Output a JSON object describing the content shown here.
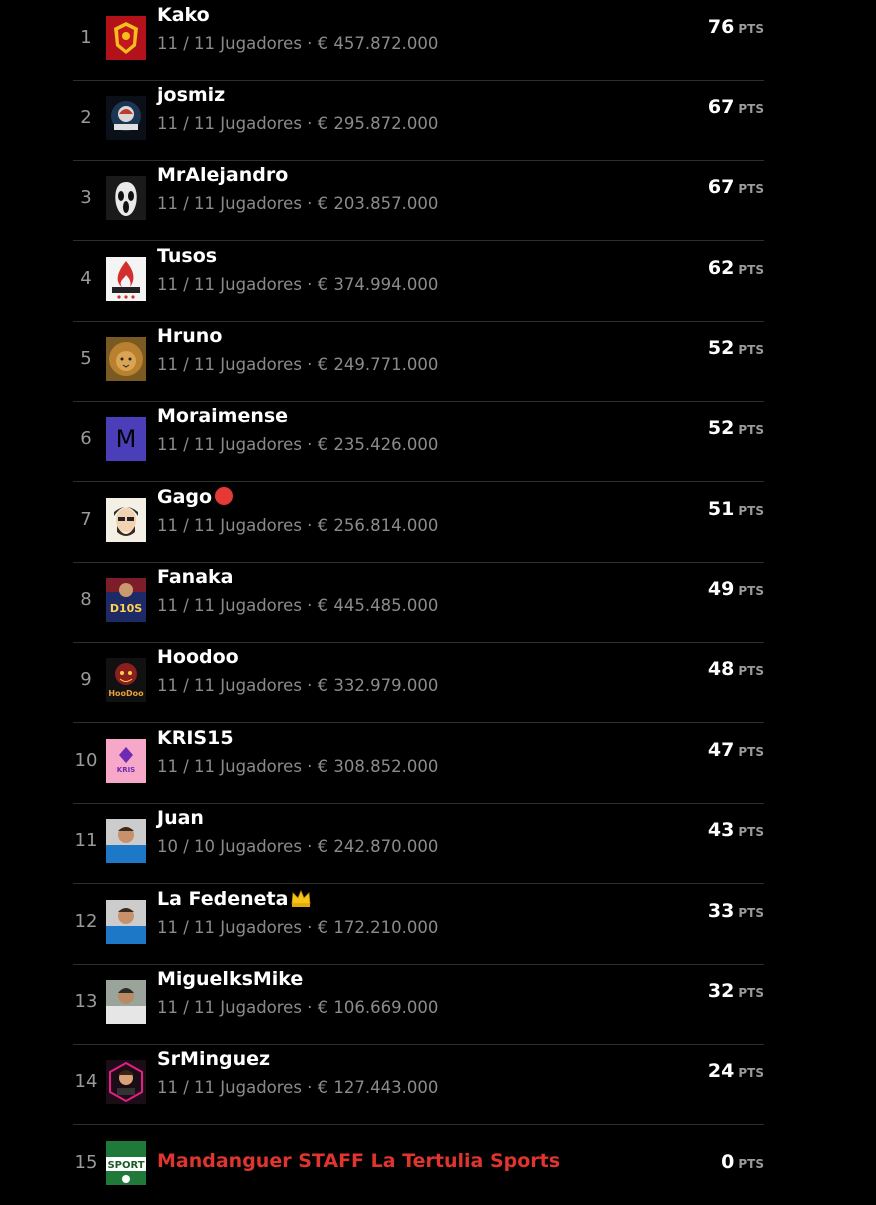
{
  "pts_unit": "PTS",
  "ranking": [
    {
      "rank": "1",
      "name": "Kako",
      "players": "11 / 11 Jugadores",
      "value": "€ 457.872.000",
      "points": "76",
      "avatar": "crest-avatar",
      "staff": false,
      "emoji": ""
    },
    {
      "rank": "2",
      "name": "josmiz",
      "players": "11 / 11 Jugadores",
      "value": "€ 295.872.000",
      "points": "67",
      "avatar": "mascot-logo-avatar",
      "staff": false,
      "emoji": ""
    },
    {
      "rank": "3",
      "name": "MrAlejandro",
      "players": "11 / 11 Jugadores",
      "value": "€ 203.857.000",
      "points": "67",
      "avatar": "ghost-mask-avatar",
      "staff": false,
      "emoji": ""
    },
    {
      "rank": "4",
      "name": "Tusos",
      "players": "11 / 11 Jugadores",
      "value": "€ 374.994.000",
      "points": "62",
      "avatar": "flame-logo-avatar",
      "staff": false,
      "emoji": ""
    },
    {
      "rank": "5",
      "name": "Hruno",
      "players": "11 / 11 Jugadores",
      "value": "€ 249.771.000",
      "points": "52",
      "avatar": "lion-avatar",
      "staff": false,
      "emoji": ""
    },
    {
      "rank": "6",
      "name": "Moraimense",
      "players": "11 / 11 Jugadores",
      "value": "€ 235.426.000",
      "points": "52",
      "avatar": "letter-avatar",
      "letter": "M",
      "staff": false,
      "emoji": ""
    },
    {
      "rank": "7",
      "name": "Gago",
      "players": "11 / 11 Jugadores",
      "value": "€ 256.814.000",
      "points": "51",
      "avatar": "cartoon-face-avatar",
      "staff": false,
      "emoji": "red-circle-icon"
    },
    {
      "rank": "8",
      "name": "Fanaka",
      "players": "11 / 11 Jugadores",
      "value": "€ 445.485.000",
      "points": "49",
      "avatar": "dios-avatar",
      "staff": false,
      "emoji": ""
    },
    {
      "rank": "9",
      "name": "Hoodoo",
      "players": "11 / 11 Jugadores",
      "value": "€ 332.979.000",
      "points": "48",
      "avatar": "hoodoo-logo-avatar",
      "staff": false,
      "emoji": ""
    },
    {
      "rank": "10",
      "name": "KRIS15",
      "players": "11 / 11 Jugadores",
      "value": "€ 308.852.000",
      "points": "47",
      "avatar": "kris-logo-avatar",
      "staff": false,
      "emoji": ""
    },
    {
      "rank": "11",
      "name": "Juan",
      "players": "10 / 10 Jugadores",
      "value": "€ 242.870.000",
      "points": "43",
      "avatar": "player-photo-avatar",
      "staff": false,
      "emoji": ""
    },
    {
      "rank": "12",
      "name": "La Fedeneta",
      "players": "11 / 11 Jugadores",
      "value": "€ 172.210.000",
      "points": "33",
      "avatar": "player-photo-avatar",
      "staff": false,
      "emoji": "crown-icon"
    },
    {
      "rank": "13",
      "name": "MiguelksMike",
      "players": "11 / 11 Jugadores",
      "value": "€ 106.669.000",
      "points": "32",
      "avatar": "person-photo-avatar",
      "staff": false,
      "emoji": ""
    },
    {
      "rank": "14",
      "name": "SrMinguez",
      "players": "11 / 11 Jugadores",
      "value": "€ 127.443.000",
      "points": "24",
      "avatar": "portrait-hexagon-avatar",
      "staff": false,
      "emoji": ""
    },
    {
      "rank": "15",
      "name": "Mandanguer STAFF La Tertulia Sports",
      "players": "",
      "value": "",
      "points": "0",
      "avatar": "sport-logo-avatar",
      "staff": true,
      "emoji": ""
    }
  ],
  "colors": {
    "background": "#000000",
    "staff_name": "#e0342e",
    "divider": "#2e2e2e",
    "subtext": "#8b8b8b",
    "letter_avatar": "#4a3fb8"
  }
}
